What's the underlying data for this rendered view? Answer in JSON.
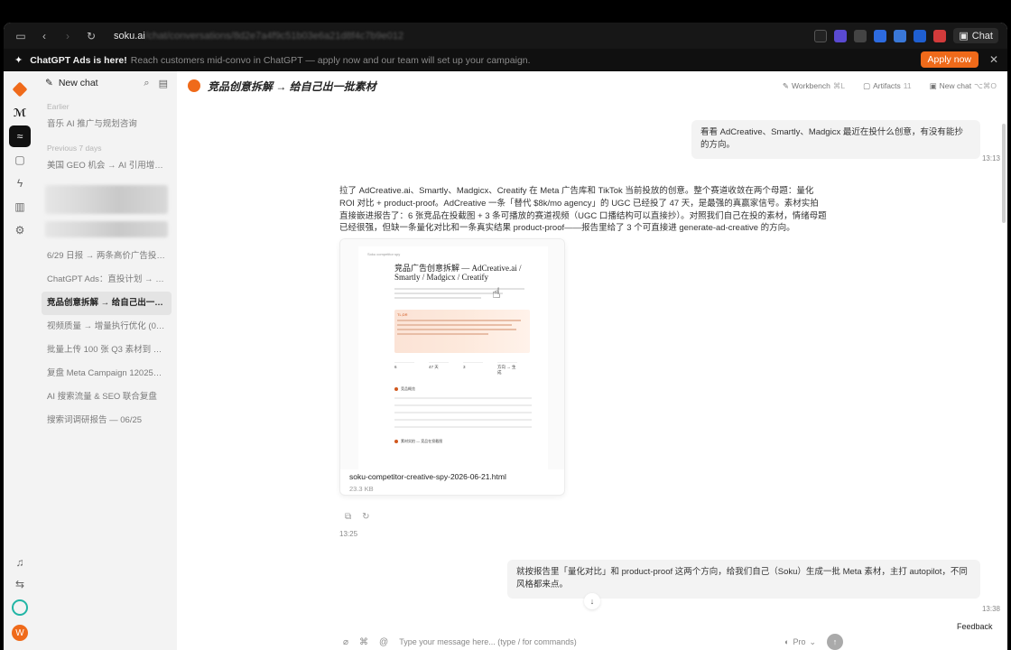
{
  "browser": {
    "url_host": "soku.ai",
    "url_path": "/chat/conversations/8d2e7a4f9c51b03e6a21d8f4c7b9e012"
  },
  "toolbar": {
    "chat_label": "Chat"
  },
  "announcement": {
    "headline": "ChatGPT Ads is here!",
    "body": "Reach customers mid-convo in ChatGPT — apply now and our team will set up your campaign.",
    "apply_label": "Apply now"
  },
  "sidebar": {
    "new_chat_label": "New chat",
    "groups": [
      {
        "label": "Earlier",
        "items": [
          "音乐 AI 推广与规划咨询"
        ]
      },
      {
        "label": "Previous 7 days",
        "items": [
          "美国 GEO 机会 → AI 引用增长计划"
        ]
      }
    ],
    "items_after_thumb": [
      "6/29 日报 → 两条高价广告投放追踪",
      "ChatGPT Ads：直投计划 → 首批素材",
      "竞品创意拆解 → 给自己出一批素材",
      "视频质量 → 增量执行优化 (06/25)",
      "批量上传 100 张 Q3 素材到 Meta",
      "复盘 Meta Campaign 12025204",
      "AI 搜索流量 & SEO 联合复盘",
      "搜索词调研报告 — 06/25"
    ],
    "active_index": 2
  },
  "main": {
    "title": "竞品创意拆解 → 给自己出一批素材",
    "actions": [
      {
        "label": "Workbench",
        "kbd": "⌘L"
      },
      {
        "label": "Artifacts",
        "kbd": "11"
      },
      {
        "label": "New chat",
        "kbd": "⌥⌘O"
      }
    ],
    "messages": {
      "user1": {
        "text": "看看 AdCreative、Smartly、Madgicx 最近在投什么创意，有没有能抄的方向。",
        "time": "13:13"
      },
      "assistant": {
        "text": "拉了 AdCreative.ai、Smartly、Madgicx、Creatify 在 Meta 广告库和 TikTok 当前投放的创意。整个赛道收敛在两个母题：量化 ROI 对比 + product-proof。AdCreative 一条「替代 $8k/mo agency」的 UGC 已经投了 47 天，是最强的真赢家信号。素材实拍直接嵌进报告了：6 张竞品在投截图 + 3 条可播放的赛道视频（UGC 口播结构可以直接抄）。对照我们自己在投的素材，情绪母题已经很强，但缺一条量化对比和一条真实结果 product-proof——报告里给了 3 个可直接进 generate-ad-creative 的方向。",
        "time": "13:25",
        "attachment": {
          "preview_kicker": "Soku competitor spy",
          "preview_title": "竞品广告创意拆解 — AdCreative.ai / Smartly / Madgicx / Creatify",
          "preview_callout": "TL;DR",
          "preview_stats": [
            "6",
            "47 天",
            "3",
            "方向 → 生成"
          ],
          "preview_section1": "竞品概览",
          "preview_section2": "素材实拍 — 竞品在投截图",
          "file_name": "soku-competitor-creative-spy-2026-06-21.html",
          "file_size": "23.3 KB"
        }
      },
      "user2": {
        "text": "就按报告里「量化对比」和 product-proof 这两个方向，给我们自己（Soku）生成一批 Meta 素材，主打 autopilot，不同风格都来点。",
        "time": "13:38"
      }
    },
    "composer": {
      "placeholder": "Type your message here... (type / for commands)",
      "model_label": "Pro"
    }
  },
  "feedback_label": "Feedback",
  "colors": {
    "accent": "#ef6a1a",
    "teal": "#21b5a5"
  }
}
